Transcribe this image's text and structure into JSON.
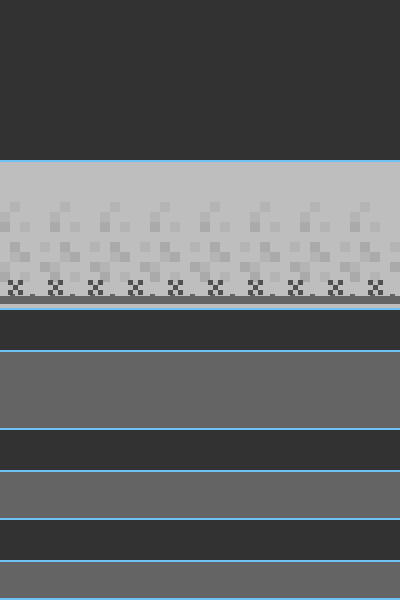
{
  "colors": {
    "background": "#323232",
    "panel_mid": "#646464",
    "divider": "#6ec3f5",
    "tile_light": "#bebebe",
    "tile_fade": "#b4b4b4",
    "tile_fade2": "#aaaaaa",
    "tile_dark": "#646464",
    "tile_darker": "#505050"
  },
  "scene": {
    "tileset_name": "pixel-ground-strip",
    "pattern": "checker-dither-border",
    "grass_tuft_count": 10
  }
}
